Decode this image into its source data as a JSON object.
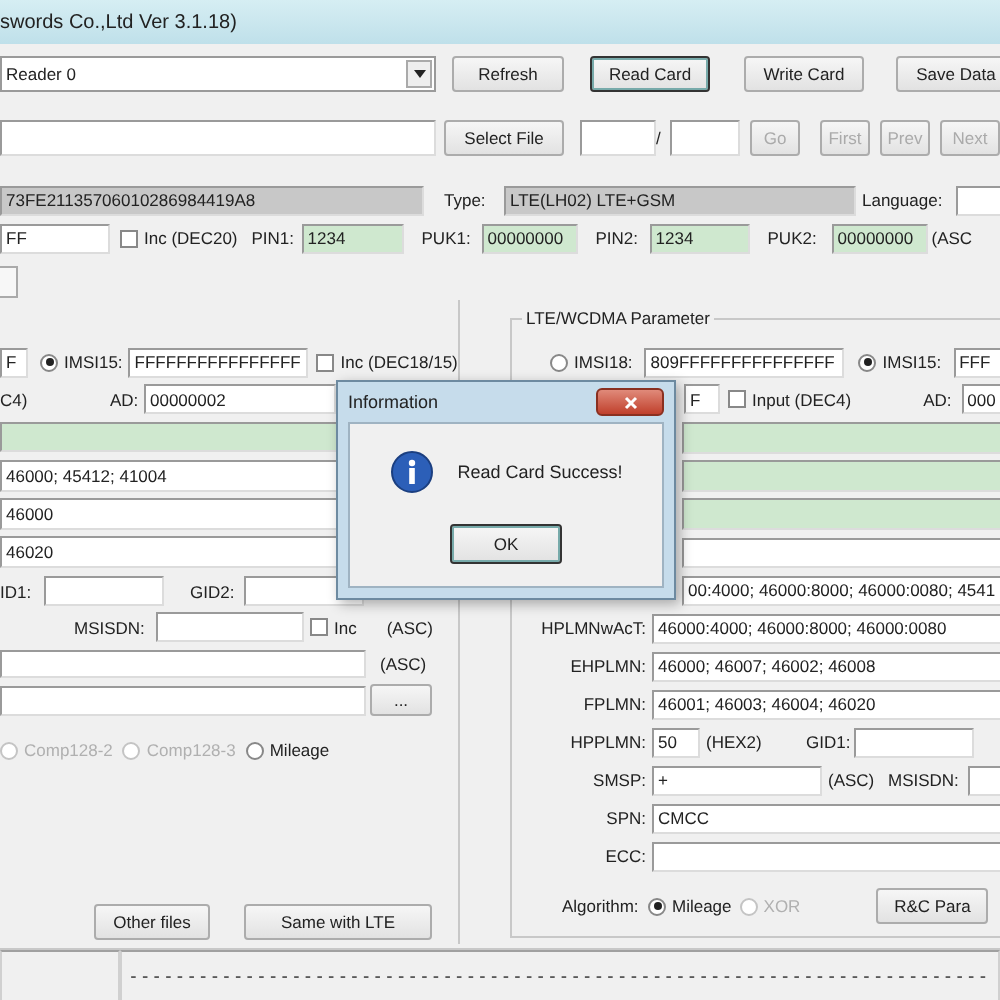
{
  "window": {
    "title": "swords Co.,Ltd Ver 3.1.18)"
  },
  "toolbar": {
    "reader": "Reader 0",
    "buttons": [
      {
        "label": "Refresh",
        "default": false
      },
      {
        "label": "Read Card",
        "default": true
      },
      {
        "label": "Write Card",
        "default": false
      },
      {
        "label": "Save Data",
        "default": false
      }
    ]
  },
  "file_bar": {
    "select": "Select File",
    "separator": "/",
    "nav": [
      {
        "label": "Go",
        "disabled": true
      },
      {
        "label": "First",
        "disabled": true
      },
      {
        "label": "Prev",
        "disabled": true
      },
      {
        "label": "Next",
        "disabled": true
      }
    ]
  },
  "card": {
    "iccid": "73FE21135706010286984419A8",
    "type_label": "Type:",
    "type": "LTE(LH02) LTE+GSM",
    "language_label": "Language:"
  },
  "codes": {
    "field_1": "FF",
    "inc": {
      "label": "Inc (DEC20)",
      "checked": false
    },
    "items": [
      {
        "label": "PIN1:",
        "value": "1234"
      },
      {
        "label": "PUK1:",
        "value": "00000000"
      },
      {
        "label": "PIN2:",
        "value": "1234"
      },
      {
        "label": "PUK2:",
        "value": "00000000"
      }
    ],
    "suffix": "(ASC"
  },
  "gsm": {
    "field_1": "F",
    "imsi": {
      "label": "IMSI15:",
      "selected": true,
      "value": "FFFFFFFFFFFFFFFF"
    },
    "inc": {
      "label": "Inc (DEC18/15)",
      "checked": false
    },
    "label_1": "C4)",
    "ad_label": "AD:",
    "ad": "00000002",
    "plmn_fields": [
      "46000; 45412; 41004",
      "46000",
      "46020"
    ],
    "gid1_label": "ID1:",
    "gid2_label": "GID2:",
    "msisdn_label": "MSISDN:",
    "msisdn_inc": {
      "label": "Inc",
      "checked": false
    },
    "asc_1": "(ASC)",
    "asc_2": "(ASC)",
    "more": "...",
    "algorithms": [
      {
        "label": "Comp128-2",
        "selected": false,
        "disabled": true
      },
      {
        "label": "Comp128-3",
        "selected": false,
        "disabled": true
      },
      {
        "label": "Mileage",
        "selected": false,
        "disabled": false
      }
    ],
    "buttons": [
      "Other files",
      "Same with LTE"
    ]
  },
  "lte": {
    "title": "LTE/WCDMA Parameter",
    "imsi": [
      {
        "label": "IMSI18:",
        "selected": false,
        "value": "809FFFFFFFFFFFFFFF"
      },
      {
        "label": "IMSI15:",
        "selected": true,
        "value": "FFF"
      }
    ],
    "field_1": "F",
    "input": {
      "label": "Input (DEC4)",
      "checked": false
    },
    "ad_label": "AD:",
    "ad": "000",
    "field_2": "00:4000; 46000:8000; 46000:0080; 4541",
    "rows": [
      {
        "label": "HPLMNwAcT:",
        "value": "46000:4000; 46000:8000; 46000:0080"
      },
      {
        "label": "EHPLMN:",
        "value": "46000; 46007; 46002; 46008"
      },
      {
        "label": "FPLMN:",
        "value": "46001; 46003; 46004; 46020"
      }
    ],
    "hpplmn": {
      "label": "HPPLMN:",
      "value": "50",
      "hint": "(HEX2)",
      "gid1_label": "GID1:"
    },
    "smsp": {
      "label": "SMSP:",
      "value": "+",
      "hint": "(ASC)",
      "msisdn_label": "MSISDN:"
    },
    "spn": {
      "label": "SPN:",
      "value": "CMCC"
    },
    "ecc": {
      "label": "ECC:"
    },
    "algorithm": {
      "label": "Algorithm:",
      "options": [
        {
          "label": "Mileage",
          "selected": true,
          "disabled": false
        },
        {
          "label": "XOR",
          "selected": false,
          "disabled": true
        }
      ],
      "button": "R&C Para"
    }
  },
  "dialog": {
    "title": "Information",
    "message": "Read Card Success!",
    "button": "OK"
  },
  "status_bar": {
    "progress": "--------------------------------------------------------------------------"
  }
}
